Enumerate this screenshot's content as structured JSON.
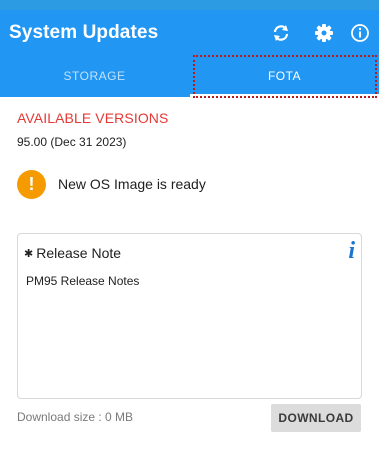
{
  "app": {
    "title": "System Updates"
  },
  "toolbar": {
    "refresh_icon": "refresh-icon",
    "settings_icon": "gear-icon",
    "info_icon": "info-circle-icon"
  },
  "tabs": [
    {
      "label": "STORAGE",
      "active": false
    },
    {
      "label": "FOTA",
      "active": true
    }
  ],
  "available": {
    "heading": "AVAILABLE VERSIONS",
    "version": "95.00 (Dec 31 2023)"
  },
  "status": {
    "badge": "!",
    "text": "New OS Image is ready"
  },
  "release_note": {
    "marker": "✱",
    "title": "Release Note",
    "info_glyph": "i",
    "body": "PM95 Release Notes"
  },
  "footer": {
    "download_size": "Download size : 0 MB",
    "download_label": "DOWNLOAD"
  },
  "colors": {
    "appbar": "#2196f3",
    "heading_red": "#e53935",
    "warning_orange": "#f59b00",
    "info_blue": "#1976d2",
    "highlight_red": "#b71c1c"
  }
}
